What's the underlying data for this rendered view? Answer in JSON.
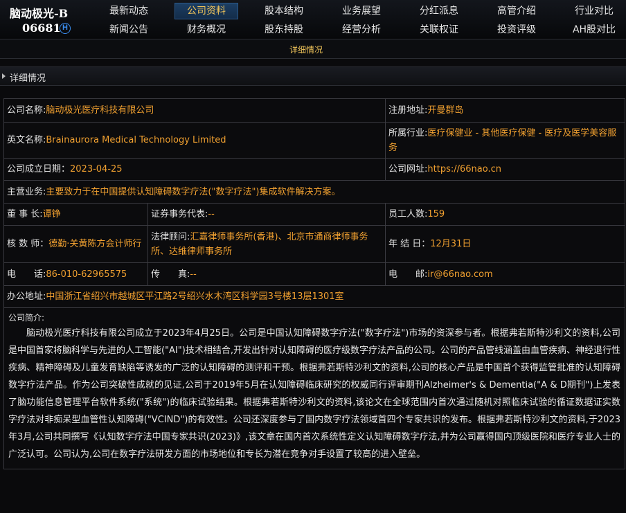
{
  "stock": {
    "name": "脑动极光-B",
    "code": "06681",
    "market_badge": "H"
  },
  "nav": {
    "row1": [
      "最新动态",
      "公司资料",
      "股本结构",
      "业务展望",
      "分红派息",
      "高管介绍",
      "行业对比"
    ],
    "row2": [
      "新闻公告",
      "财务概况",
      "股东持股",
      "经营分析",
      "关联权证",
      "投资评级",
      "AH股对比"
    ],
    "active": "公司资料"
  },
  "subnav": {
    "active_tab": "详细情况"
  },
  "section": {
    "title": "详细情况"
  },
  "info": {
    "company_name_label": "公司名称:",
    "company_name": "脑动极光医疗科技有限公司",
    "reg_addr_label": "注册地址:",
    "reg_addr": "开曼群岛",
    "en_name_label": "英文名称:",
    "en_name": "Brainaurora Medical Technology Limited",
    "industry_label": "所属行业:",
    "industry": "医疗保健业 - 其他医疗保健 - 医疗及医学美容服务",
    "founded_label": "公司成立日期：",
    "founded": "2023-04-25",
    "website_label": "公司网址:",
    "website": "https://66nao.cn",
    "business_label": "主营业务:",
    "business": "主要致力于在中国提供认知障碍数字疗法(\"数字疗法\")集成软件解决方案。",
    "chairman_label": "董 事 长:",
    "chairman": "谭铮",
    "secretary_label": "证券事务代表:",
    "secretary": "--",
    "employees_label": "员工人数:",
    "employees": "159",
    "auditor_label": "核 数 师：",
    "auditor": "德勤·关黄陈方会计师行",
    "legal_label": "法律顾问:",
    "legal": "汇嘉律师事务所(香港)、北京市通商律师事务所、达维律师事务所",
    "fiscal_label": "年 结 日：",
    "fiscal": "12月31日",
    "phone_label": "电　　话:",
    "phone": "86-010-62965575",
    "fax_label": "传　　真:",
    "fax": "--",
    "email_label": "电　　邮:",
    "email": "ir@66nao.com",
    "office_label": "办公地址:",
    "office": "中国浙江省绍兴市越城区平江路2号绍兴水木湾区科学园3号楼13层1301室",
    "profile_label": "公司简介:",
    "profile": "脑动极光医疗科技有限公司成立于2023年4月25日。公司是中国认知障碍数字疗法(\"数字疗法\")市场的资深参与者。根据弗若斯特沙利文的资料,公司是中国首家将脑科学与先进的人工智能(\"AI\")技术相结合,开发出针对认知障碍的医疗级数字疗法产品的公司。公司的产品管线涵盖由血管疾病、神经退行性疾病、精神障碍及儿童发育缺陷等诱发的广泛的认知障碍的测评和干预。根据弗若斯特沙利文的资料,公司的核心产品是中国首个获得监管批准的认知障碍数字疗法产品。作为公司突破性成就的见证,公司于2019年5月在认知障碍临床研究的权威同行评审期刊Alzheimer's & Dementia(\"A & D期刊\")上发表了脑功能信息管理平台软件系统(\"系统\")的临床试验结果。根据弗若斯特沙利文的资料,该论文在全球范围内首次通过随机对照临床试验的循证数据证实数字疗法对非痴呆型血管性认知障碍(\"VCIND\")的有效性。公司还深度参与了国内数字疗法领域首四个专家共识的发布。根据弗若斯特沙利文的资料,于2023年3月,公司共同撰写《认知数字疗法中国专家共识(2023)》,该文章在国内首次系统性定义认知障碍数字疗法,并为公司赢得国内顶级医院和医疗专业人士的广泛认可。公司认为,公司在数字疗法研发方面的市场地位和专长为潜在竞争对手设置了较高的进入壁垒。"
  }
}
